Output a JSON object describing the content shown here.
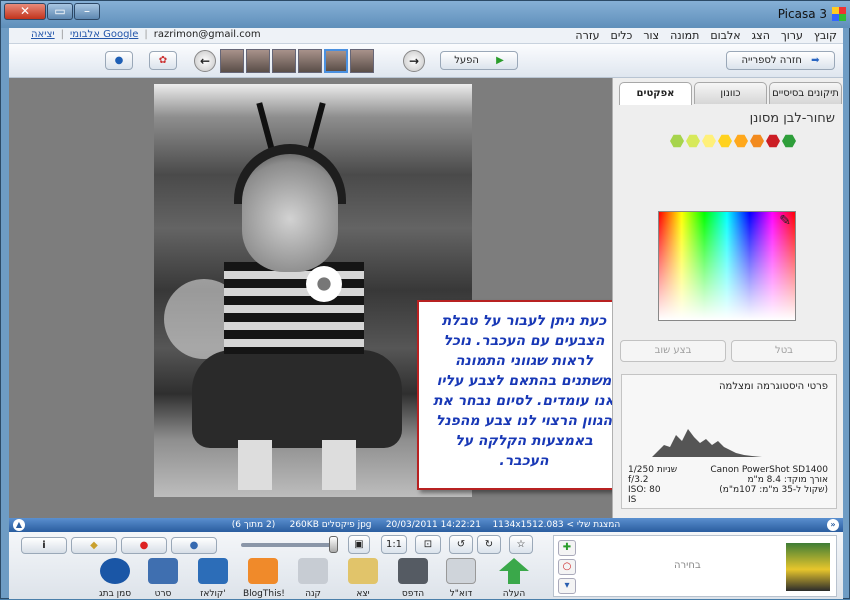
{
  "window": {
    "title": "Picasa 3"
  },
  "menu": [
    "קובץ",
    "ערוך",
    "הצג",
    "אלבום",
    "תמונה",
    "צור",
    "כלים",
    "עזרה"
  ],
  "account": {
    "exit": "יציאה",
    "albums": "אלבומי Google",
    "separator": "|",
    "email": "razrimon@gmail.com"
  },
  "toolbar": {
    "back_label": "חזרה לספרייה",
    "play_label": "הפעל"
  },
  "panel": {
    "tabs": [
      "תיקונים בסיסיים",
      "כוונון",
      "אפקטים"
    ],
    "title": "שחור-לבן מסונן",
    "swatch_colors": [
      "#2e9e3a",
      "#cc1d24",
      "#f28a1e",
      "#ffa81c",
      "#ffd21f",
      "#fff07a",
      "#d7e95a",
      "#a6d44c"
    ],
    "cancel_label": "בטל",
    "apply_label": "בצע שוב",
    "histogram_title": "פרטי היסטוגרמה ומצלמה",
    "camera": "Canon PowerShot SD1400",
    "focal": "אורך מוקד: 8.4 מ\"מ",
    "equiv": "(שקול ל-35 מ\"מ: 107מ\"מ)",
    "flag": "IS",
    "shutter": "1/250 שניות",
    "aperture": "f/3.2",
    "iso": "ISO: 80"
  },
  "callout": {
    "text": "כעת ניתן לעבור על טבלת הצבעים עם העכבר. נוכל לראות שגווני התמונה משתנים בהתאם לצבע עליו אנו עומדים. לסיום נבחר את הגוון הרצוי לנו צבע מהפנל באמצעות הקלקה על העכבר."
  },
  "status": {
    "next": "המצגת שלי > 083.jpg",
    "date": "20/03/2011",
    "time": "14:22:21",
    "dims": "1134x1512 פיקסלים",
    "size": "260KB",
    "count": "(2 מתוך 6)"
  },
  "bottom": {
    "actions": [
      {
        "label": "העלה",
        "color": "#3aa84a"
      },
      {
        "label": "דוא\"ל",
        "color": "#cfd4da"
      },
      {
        "label": "הדפס",
        "color": "#555b63"
      },
      {
        "label": "יצא",
        "color": "#e1c46a"
      },
      {
        "label": "קנה",
        "color": "#c7ccd3"
      },
      {
        "label": "BlogThis!",
        "color": "#f08a2a"
      },
      {
        "label": "קולאז'",
        "color": "#2c6db8"
      },
      {
        "label": "סרט",
        "color": "#3f6fb0"
      },
      {
        "label": "סמן בתג",
        "color": "#1a56a6"
      }
    ],
    "tray_label": "בחירה"
  }
}
